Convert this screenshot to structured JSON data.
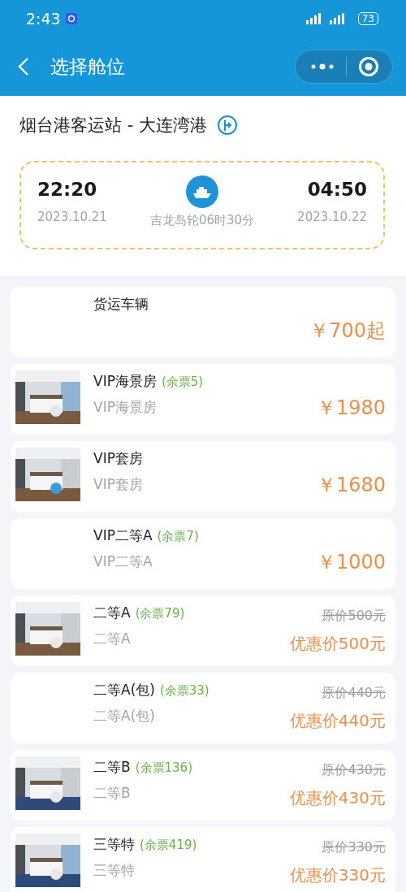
{
  "status_bar": {
    "time": "2:43",
    "battery": "73"
  },
  "nav": {
    "title": "选择舱位"
  },
  "route": {
    "title": "烟台港客运站 - 大连湾港"
  },
  "voyage": {
    "depart_time": "22:20",
    "depart_date": "2023.10.21",
    "ship": "吉龙岛轮06时30分",
    "arrive_time": "04:50",
    "arrive_date": "2023.10.22"
  },
  "cabins": [
    {
      "kind": "plain",
      "photo": false,
      "name": "货运车辆",
      "price": "￥700起"
    },
    {
      "kind": "plain",
      "photo": true,
      "name": "VIP海景房",
      "remaining": "(余票5)",
      "subtitle": "VIP海景房",
      "price": "￥1980"
    },
    {
      "kind": "plain",
      "photo": true,
      "name": "VIP套房",
      "subtitle": "VIP套房",
      "price": "￥1680"
    },
    {
      "kind": "plain",
      "photo": false,
      "name": "VIP二等A",
      "remaining": "(余票7)",
      "subtitle": "VIP二等A",
      "price": "￥1000"
    },
    {
      "kind": "discount",
      "photo": true,
      "name": "二等A",
      "remaining": "(余票79)",
      "subtitle": "二等A",
      "original": "原价500元",
      "price": "优惠价500元"
    },
    {
      "kind": "discount",
      "photo": false,
      "name": "二等A(包)",
      "remaining": "(余票33)",
      "subtitle": "二等A(包)",
      "original": "原价440元",
      "price": "优惠价440元"
    },
    {
      "kind": "discount",
      "photo": true,
      "name": "二等B",
      "remaining": "(余票136)",
      "subtitle": "二等B",
      "original": "原价430元",
      "price": "优惠价430元"
    },
    {
      "kind": "discount",
      "photo": true,
      "name": "三等特",
      "remaining": "(余票419)",
      "subtitle": "三等特",
      "original": "原价330元",
      "price": "优惠价330元"
    }
  ]
}
